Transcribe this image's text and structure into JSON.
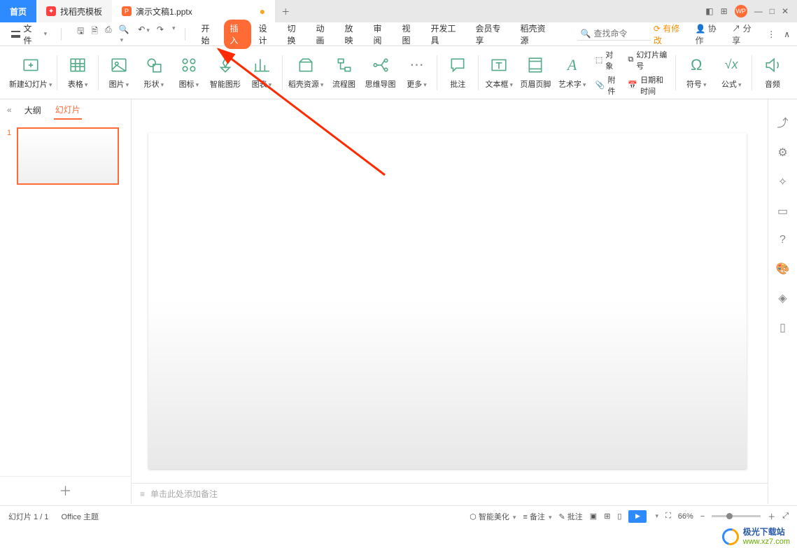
{
  "tabs": {
    "home": "首页",
    "docell": "找稻壳模板",
    "doc": "演示文稿1.pptx"
  },
  "file_menu": "文件",
  "menu_tabs": [
    "开始",
    "插入",
    "设计",
    "切换",
    "动画",
    "放映",
    "审阅",
    "视图",
    "开发工具",
    "会员专享",
    "稻壳资源"
  ],
  "active_menu_tab": 1,
  "search": {
    "placeholder": "查找命令"
  },
  "top_right": {
    "modified": "有修改",
    "collab": "协作",
    "share": "分享"
  },
  "ribbon": {
    "new_slide": "新建幻灯片",
    "table": "表格",
    "picture": "图片",
    "shape": "形状",
    "icon": "图标",
    "smart": "智能图形",
    "chart": "图表",
    "docell_res": "稻壳资源",
    "flowchart": "流程图",
    "mindmap": "思维导图",
    "more": "更多",
    "comment": "批注",
    "textbox": "文本框",
    "header_footer": "页眉页脚",
    "wordart": "艺术字",
    "object": "对象",
    "attach": "附件",
    "slide_num": "幻灯片编号",
    "datetime": "日期和时间",
    "symbol": "符号",
    "formula": "公式",
    "audio": "音频"
  },
  "left_panel": {
    "outline": "大纲",
    "slides": "幻灯片",
    "slide_number": "1"
  },
  "notes_placeholder": "单击此处添加备注",
  "status": {
    "slide_info": "幻灯片 1 / 1",
    "theme": "Office 主题",
    "beautify": "智能美化",
    "notes": "备注",
    "comments": "批注",
    "zoom": "66%"
  },
  "watermark": {
    "line1": "极光下载站",
    "line2": "www.xz7.com"
  },
  "icons": {
    "obj": "⬚",
    "attach": "📎",
    "num": "#",
    "date": "📅"
  }
}
